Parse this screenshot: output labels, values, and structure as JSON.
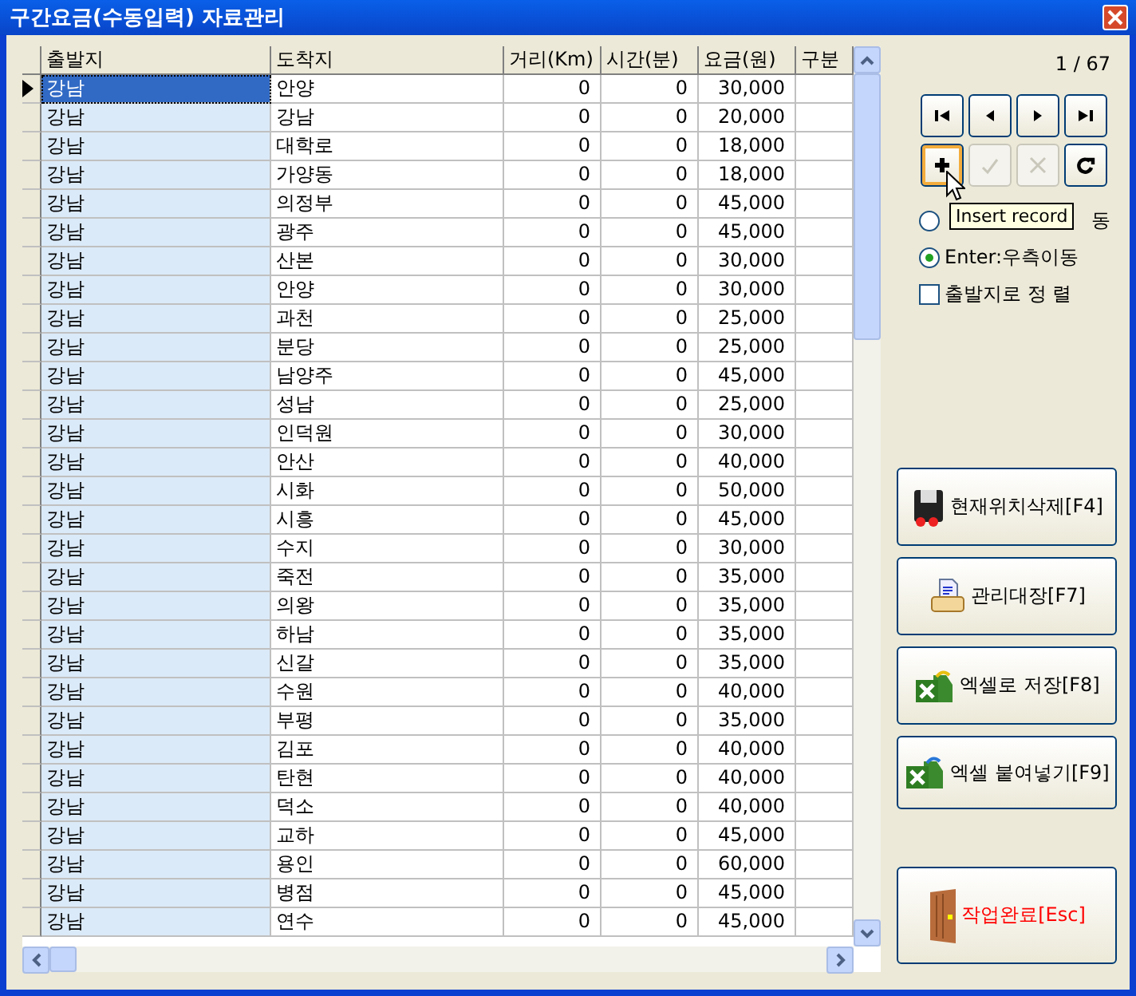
{
  "window": {
    "title": "구간요금(수동입력) 자료관리"
  },
  "table": {
    "columns": [
      "출발지",
      "도착지",
      "거리(Km)",
      "시간(분)",
      "요금(원)",
      "구분"
    ],
    "rows": [
      {
        "from": "강남",
        "to": "안양",
        "distance": "0",
        "time": "0",
        "fare": "30,000",
        "selected": true
      },
      {
        "from": "강남",
        "to": "강남",
        "distance": "0",
        "time": "0",
        "fare": "20,000",
        "selected": false
      },
      {
        "from": "강남",
        "to": "대학로",
        "distance": "0",
        "time": "0",
        "fare": "18,000",
        "selected": false
      },
      {
        "from": "강남",
        "to": "가양동",
        "distance": "0",
        "time": "0",
        "fare": "18,000",
        "selected": false
      },
      {
        "from": "강남",
        "to": "의정부",
        "distance": "0",
        "time": "0",
        "fare": "45,000",
        "selected": false
      },
      {
        "from": "강남",
        "to": "광주",
        "distance": "0",
        "time": "0",
        "fare": "45,000",
        "selected": false
      },
      {
        "from": "강남",
        "to": "산본",
        "distance": "0",
        "time": "0",
        "fare": "30,000",
        "selected": false
      },
      {
        "from": "강남",
        "to": "안양",
        "distance": "0",
        "time": "0",
        "fare": "30,000",
        "selected": false
      },
      {
        "from": "강남",
        "to": "과천",
        "distance": "0",
        "time": "0",
        "fare": "25,000",
        "selected": false
      },
      {
        "from": "강남",
        "to": "분당",
        "distance": "0",
        "time": "0",
        "fare": "25,000",
        "selected": false
      },
      {
        "from": "강남",
        "to": "남양주",
        "distance": "0",
        "time": "0",
        "fare": "45,000",
        "selected": false
      },
      {
        "from": "강남",
        "to": "성남",
        "distance": "0",
        "time": "0",
        "fare": "25,000",
        "selected": false
      },
      {
        "from": "강남",
        "to": "인덕원",
        "distance": "0",
        "time": "0",
        "fare": "30,000",
        "selected": false
      },
      {
        "from": "강남",
        "to": "안산",
        "distance": "0",
        "time": "0",
        "fare": "40,000",
        "selected": false
      },
      {
        "from": "강남",
        "to": "시화",
        "distance": "0",
        "time": "0",
        "fare": "50,000",
        "selected": false
      },
      {
        "from": "강남",
        "to": "시흥",
        "distance": "0",
        "time": "0",
        "fare": "45,000",
        "selected": false
      },
      {
        "from": "강남",
        "to": "수지",
        "distance": "0",
        "time": "0",
        "fare": "30,000",
        "selected": false
      },
      {
        "from": "강남",
        "to": "죽전",
        "distance": "0",
        "time": "0",
        "fare": "35,000",
        "selected": false
      },
      {
        "from": "강남",
        "to": "의왕",
        "distance": "0",
        "time": "0",
        "fare": "35,000",
        "selected": false
      },
      {
        "from": "강남",
        "to": "하남",
        "distance": "0",
        "time": "0",
        "fare": "35,000",
        "selected": false
      },
      {
        "from": "강남",
        "to": "신갈",
        "distance": "0",
        "time": "0",
        "fare": "35,000",
        "selected": false
      },
      {
        "from": "강남",
        "to": "수원",
        "distance": "0",
        "time": "0",
        "fare": "40,000",
        "selected": false
      },
      {
        "from": "강남",
        "to": "부평",
        "distance": "0",
        "time": "0",
        "fare": "35,000",
        "selected": false
      },
      {
        "from": "강남",
        "to": "김포",
        "distance": "0",
        "time": "0",
        "fare": "40,000",
        "selected": false
      },
      {
        "from": "강남",
        "to": "탄현",
        "distance": "0",
        "time": "0",
        "fare": "40,000",
        "selected": false
      },
      {
        "from": "강남",
        "to": "덕소",
        "distance": "0",
        "time": "0",
        "fare": "40,000",
        "selected": false
      },
      {
        "from": "강남",
        "to": "교하",
        "distance": "0",
        "time": "0",
        "fare": "45,000",
        "selected": false
      },
      {
        "from": "강남",
        "to": "용인",
        "distance": "0",
        "time": "0",
        "fare": "60,000",
        "selected": false
      },
      {
        "from": "강남",
        "to": "병점",
        "distance": "0",
        "time": "0",
        "fare": "45,000",
        "selected": false
      },
      {
        "from": "강남",
        "to": "연수",
        "distance": "0",
        "time": "0",
        "fare": "45,000",
        "selected": false
      }
    ]
  },
  "record_counter": "1 / 67",
  "navigator": [
    {
      "kind": "first",
      "disabled": false,
      "focused": false
    },
    {
      "kind": "prev",
      "disabled": false,
      "focused": false
    },
    {
      "kind": "next",
      "disabled": false,
      "focused": false
    },
    {
      "kind": "last",
      "disabled": false,
      "focused": false
    },
    {
      "kind": "insert",
      "disabled": false,
      "focused": true
    },
    {
      "kind": "post",
      "disabled": true,
      "focused": false
    },
    {
      "kind": "cancel",
      "disabled": true,
      "focused": false
    },
    {
      "kind": "refresh",
      "disabled": false,
      "focused": false
    }
  ],
  "tooltip": "Insert record",
  "enter_options": [
    {
      "label": "동",
      "selected": false
    },
    {
      "label": "Enter:우측이동",
      "selected": true
    }
  ],
  "sort_checkbox": {
    "label": "출발지로 정 렬",
    "checked": false
  },
  "actions": [
    {
      "kind": "delete",
      "label": "현재위치삭제[F4]"
    },
    {
      "kind": "print",
      "label": "관리대장[F7]"
    },
    {
      "kind": "excel-save",
      "label": "엑셀로 저장[F8]"
    },
    {
      "kind": "excel-paste",
      "label": "엑셀 붙여넣기[F9]"
    },
    {
      "kind": "exit",
      "label": "작업완료[Esc]"
    }
  ]
}
